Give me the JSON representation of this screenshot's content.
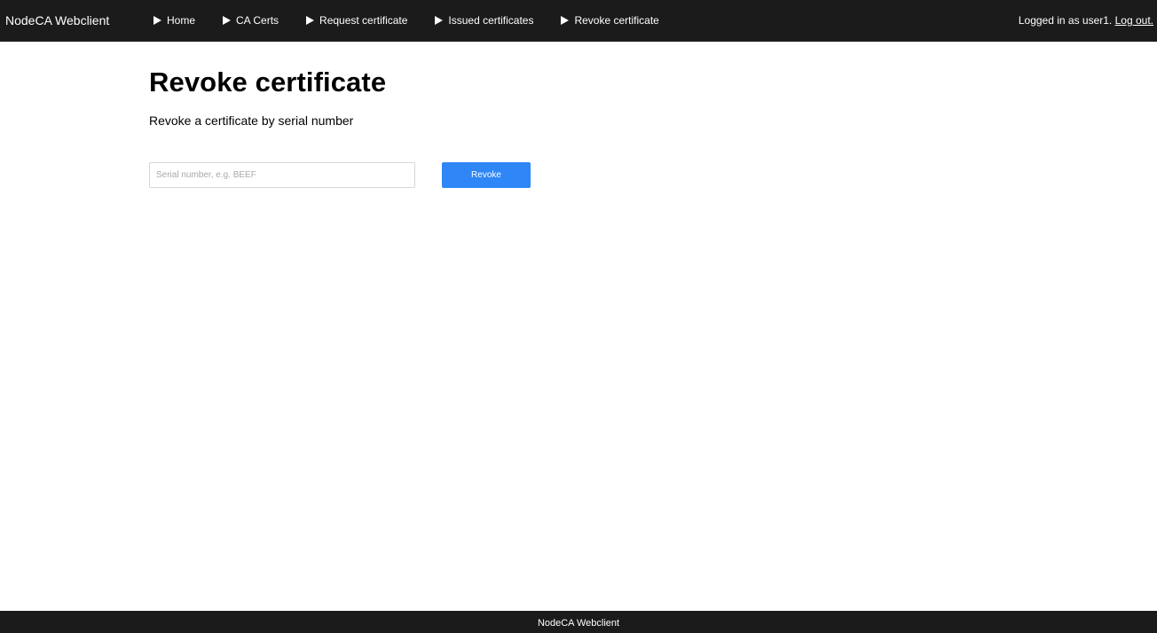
{
  "header": {
    "brand": "NodeCA Webclient",
    "nav": [
      {
        "label": "Home",
        "icon": "play-icon"
      },
      {
        "label": "CA Certs",
        "icon": "play-icon"
      },
      {
        "label": "Request certificate",
        "icon": "play-icon"
      },
      {
        "label": "Issued certificates",
        "icon": "play-icon"
      },
      {
        "label": "Revoke certificate",
        "icon": "play-icon"
      }
    ],
    "user_text": "Logged in as user1.",
    "logout_label": "Log out."
  },
  "main": {
    "title": "Revoke certificate",
    "subtitle": "Revoke a certificate by serial number",
    "form": {
      "serial_value": "",
      "serial_placeholder": "Serial number, e.g. BEEF",
      "submit_label": "Revoke"
    }
  },
  "footer": {
    "text": "NodeCA Webclient"
  },
  "colors": {
    "header_bg": "#1b1b1b",
    "accent": "#2f86f6",
    "text": "#000000",
    "header_text": "#ffffff"
  }
}
